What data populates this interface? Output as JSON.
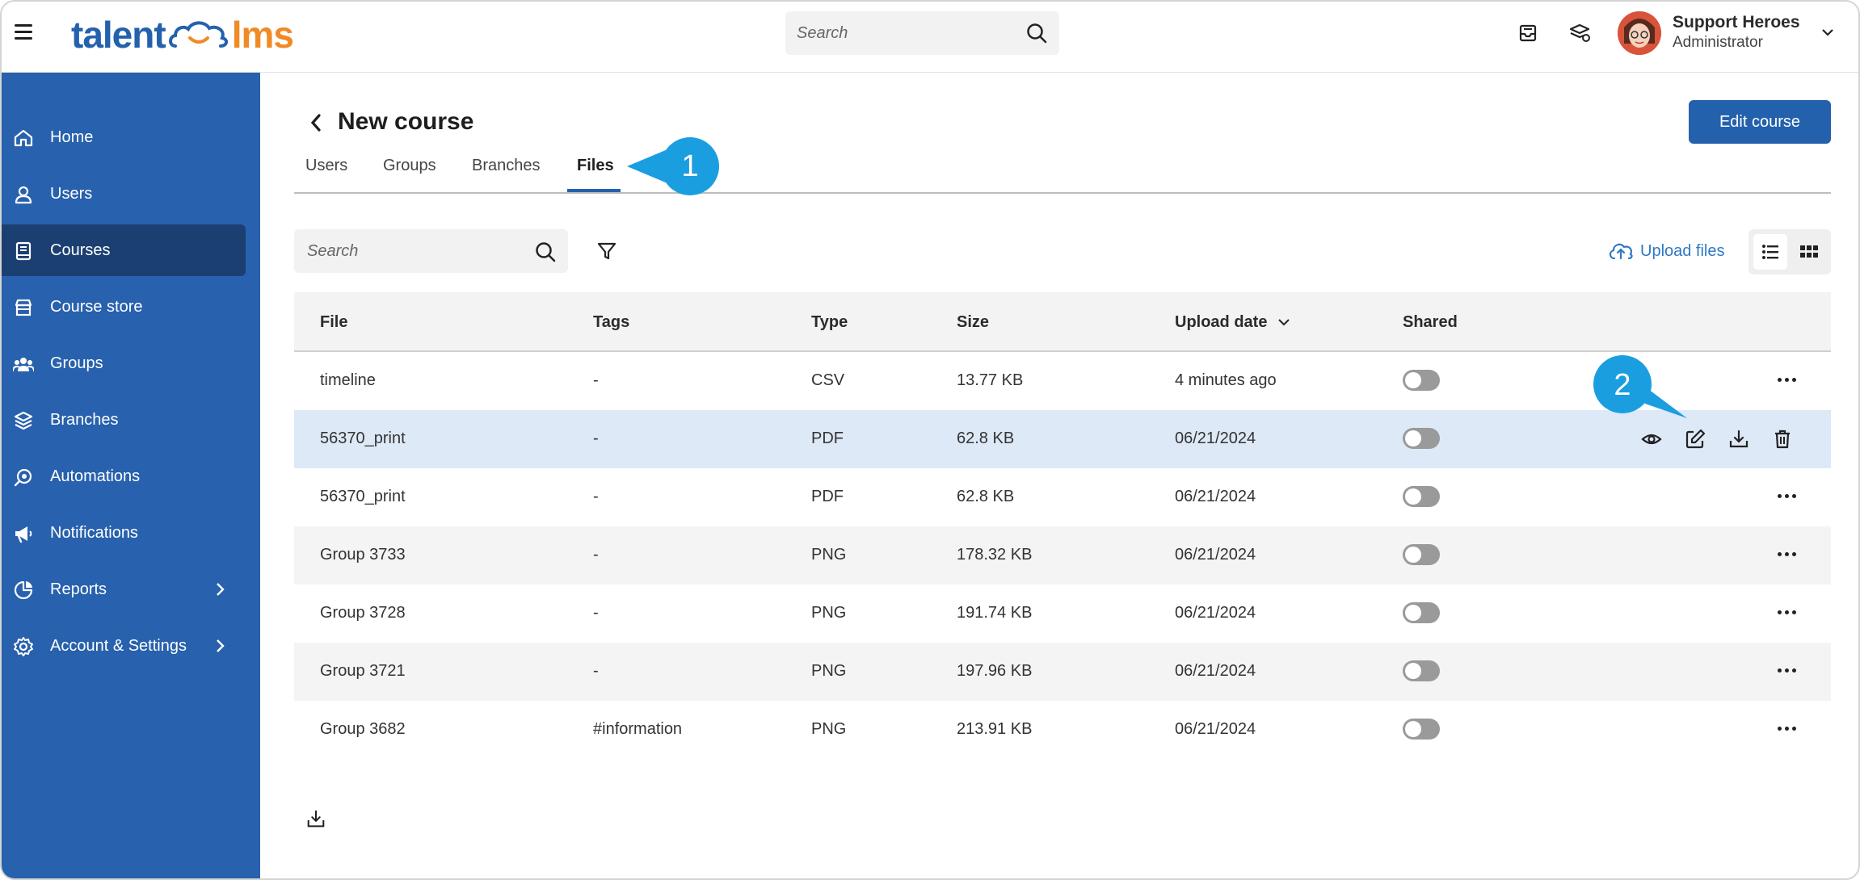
{
  "header": {
    "logo_left": "talent",
    "logo_right": "lms",
    "search_placeholder": "Search",
    "user_name": "Support Heroes",
    "user_role": "Administrator"
  },
  "sidebar": {
    "items": [
      {
        "label": "Home",
        "icon": "home-icon"
      },
      {
        "label": "Users",
        "icon": "user-icon"
      },
      {
        "label": "Courses",
        "icon": "book-icon",
        "active": true
      },
      {
        "label": "Course store",
        "icon": "store-icon"
      },
      {
        "label": "Groups",
        "icon": "groups-icon"
      },
      {
        "label": "Branches",
        "icon": "layers-icon"
      },
      {
        "label": "Automations",
        "icon": "automation-icon"
      },
      {
        "label": "Notifications",
        "icon": "megaphone-icon"
      },
      {
        "label": "Reports",
        "icon": "pie-chart-icon",
        "has_submenu": true
      },
      {
        "label": "Account & Settings",
        "icon": "gear-icon",
        "has_submenu": true
      }
    ]
  },
  "page": {
    "title": "New course",
    "edit_button": "Edit course",
    "tabs": [
      "Users",
      "Groups",
      "Branches",
      "Files"
    ],
    "active_tab": "Files",
    "callouts": [
      "1",
      "2"
    ]
  },
  "files": {
    "search_placeholder": "Search",
    "upload_label": "Upload files",
    "columns": [
      "File",
      "Tags",
      "Type",
      "Size",
      "Upload date",
      "Shared"
    ],
    "rows": [
      {
        "file": "timeline",
        "tags": "-",
        "type": "CSV",
        "size": "13.77 KB",
        "date": "4 minutes ago",
        "shared": false
      },
      {
        "file": "56370_print",
        "tags": "-",
        "type": "PDF",
        "size": "62.8 KB",
        "date": "06/21/2024",
        "shared": false
      },
      {
        "file": "56370_print",
        "tags": "-",
        "type": "PDF",
        "size": "62.8 KB",
        "date": "06/21/2024",
        "shared": false
      },
      {
        "file": "Group 3733",
        "tags": "-",
        "type": "PNG",
        "size": "178.32 KB",
        "date": "06/21/2024",
        "shared": false
      },
      {
        "file": "Group 3728",
        "tags": "-",
        "type": "PNG",
        "size": "191.74 KB",
        "date": "06/21/2024",
        "shared": false
      },
      {
        "file": "Group 3721",
        "tags": "-",
        "type": "PNG",
        "size": "197.96 KB",
        "date": "06/21/2024",
        "shared": false
      },
      {
        "file": "Group 3682",
        "tags": "#information",
        "type": "PNG",
        "size": "213.91 KB",
        "date": "06/21/2024",
        "shared": false
      }
    ]
  },
  "colors": {
    "brand_blue": "#2461ad",
    "sidebar": "#2861ad",
    "sidebar_active": "#1c3f72",
    "logo_orange": "#f08a24",
    "callout": "#1a9ee0",
    "row_highlight": "#dde9f6"
  }
}
